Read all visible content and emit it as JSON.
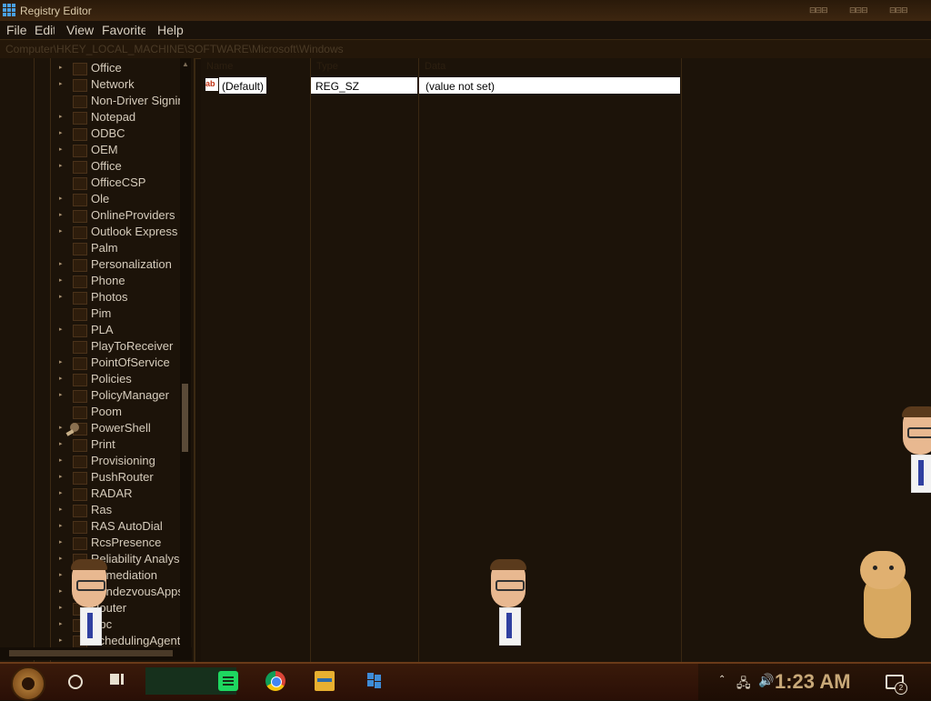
{
  "window": {
    "title": "Registry Editor",
    "min": "⊟⊟⊟",
    "max": "⊟⊟⊟",
    "close": "⊟⊟⊟"
  },
  "menu": [
    "File",
    "Edit",
    "View",
    "Favorites",
    "Help"
  ],
  "address": "Computer\\HKEY_LOCAL_MACHINE\\SOFTWARE\\Microsoft\\Windows",
  "tree": {
    "items": [
      {
        "label": "Office",
        "expandable": true
      },
      {
        "label": "Network",
        "expandable": true
      },
      {
        "label": "Non-Driver Signing",
        "expandable": false
      },
      {
        "label": "Notepad",
        "expandable": true
      },
      {
        "label": "ODBC",
        "expandable": true
      },
      {
        "label": "OEM",
        "expandable": true
      },
      {
        "label": "Office",
        "expandable": true
      },
      {
        "label": "OfficeCSP",
        "expandable": false
      },
      {
        "label": "Ole",
        "expandable": true
      },
      {
        "label": "OnlineProviders",
        "expandable": true
      },
      {
        "label": "Outlook Express",
        "expandable": true
      },
      {
        "label": "Palm",
        "expandable": false
      },
      {
        "label": "Personalization",
        "expandable": true
      },
      {
        "label": "Phone",
        "expandable": true
      },
      {
        "label": "Photos",
        "expandable": true
      },
      {
        "label": "Pim",
        "expandable": false
      },
      {
        "label": "PLA",
        "expandable": true
      },
      {
        "label": "PlayToReceiver",
        "expandable": false
      },
      {
        "label": "PointOfService",
        "expandable": true
      },
      {
        "label": "Policies",
        "expandable": true
      },
      {
        "label": "PolicyManager",
        "expandable": true
      },
      {
        "label": "Poom",
        "expandable": false
      },
      {
        "label": "PowerShell",
        "expandable": true
      },
      {
        "label": "Print",
        "expandable": true
      },
      {
        "label": "Provisioning",
        "expandable": true
      },
      {
        "label": "PushRouter",
        "expandable": true
      },
      {
        "label": "RADAR",
        "expandable": true
      },
      {
        "label": "Ras",
        "expandable": true
      },
      {
        "label": "RAS AutoDial",
        "expandable": true
      },
      {
        "label": "RcsPresence",
        "expandable": true
      },
      {
        "label": "Reliability Analysis",
        "expandable": true
      },
      {
        "label": "Remediation",
        "expandable": true
      },
      {
        "label": "RendezvousApps",
        "expandable": true
      },
      {
        "label": "Router",
        "expandable": true
      },
      {
        "label": "Rpc",
        "expandable": true
      },
      {
        "label": "SchedulingAgent",
        "expandable": true
      }
    ]
  },
  "columns": {
    "name": "Name",
    "type": "Type",
    "data": "Data"
  },
  "values": [
    {
      "icon": "ab",
      "name": "(Default)",
      "type": "REG_SZ",
      "data": "(value not set)"
    }
  ],
  "taskbar": {
    "clock": "1:23 AM",
    "notification_count": "2",
    "apps": [
      "spotify-icon",
      "chrome-icon",
      "file-explorer-icon",
      "registry-editor-icon"
    ]
  }
}
